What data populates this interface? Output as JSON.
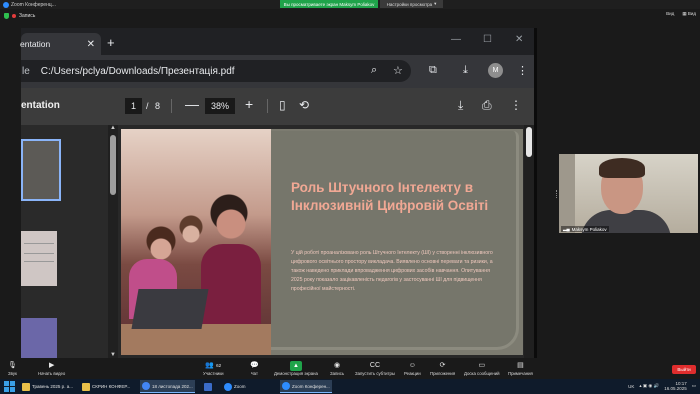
{
  "zoom": {
    "app_title": "Zoom Конференц...",
    "share_banner": "Вы просматриваете экран Maksym Poliakov",
    "share_options": "Настройки просмотра",
    "share_options_arrow": "▾",
    "recording_label": "Запись",
    "view_label": "Вид",
    "top_view_label": "Вид"
  },
  "browser": {
    "tab_title": "entation",
    "tab_close": "✕",
    "new_tab": "+",
    "url_prefix": "le",
    "url": "C:/Users/pclya/Downloads/Презентація.pdf",
    "avatar_letter": "M",
    "minimize": "—",
    "maximize": "☐",
    "close": "✕"
  },
  "pdf": {
    "title": "entation",
    "current_page": "1",
    "page_sep": "/",
    "total_pages": "8",
    "zoom_level": "38%",
    "zoom_minus": "—",
    "zoom_plus": "+"
  },
  "slide": {
    "title": "Роль Штучного Інтелекту в Інклюзивній Цифровій Освіті",
    "body": "У цій роботі проаналізовано роль Штучного Інтелекту (ШІ) у створенні інклюзивного цифрового освітнього простору викладача. Виявлено основні переваги та ризики, а також наведено приклади впровадження цифрових засобів навчання. Опитування 2025 року показало зацікавленість педагогів у застосуванні ШІ для підвищення професійної майстерності."
  },
  "participant": {
    "name": "Maksym Poliakov"
  },
  "toolbar": {
    "audio": "Звук",
    "video": "Начать видео",
    "participants": "Участники",
    "participants_count": "62",
    "chat": "Чат",
    "share": "Демонстрация экрана",
    "record": "Запись",
    "captions": "Запустить субтитры",
    "reactions": "Реакции",
    "apps": "Приложения",
    "whiteboard": "Доска сообщений",
    "notes": "Примечания",
    "leave": "Выйти"
  },
  "taskbar": {
    "apps": [
      {
        "label": "Травень 2025 р. а...",
        "color": "#e8c04a"
      },
      {
        "label": "СКРИН КОНФЕР...",
        "color": "#e8c04a"
      },
      {
        "label": "18 листопада 202...",
        "color": "#4285f4"
      },
      {
        "label": "",
        "color": "#3a6cc9"
      },
      {
        "label": "Zoom",
        "color": "#2d8cff"
      },
      {
        "label": "Zoom Конферен...",
        "color": "#2d8cff"
      }
    ],
    "lang": "UK",
    "time": "10:17",
    "date": "16.05.2025"
  }
}
